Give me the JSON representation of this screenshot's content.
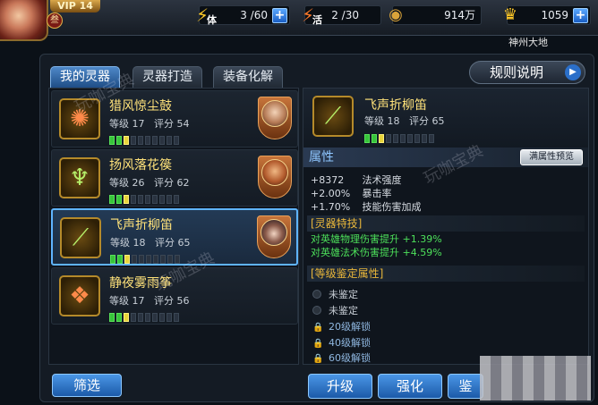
{
  "header": {
    "vip_label": "VIP 14",
    "vip_rank": "叁",
    "stamina": {
      "icon_label": "体",
      "value": "3 /60"
    },
    "vitality": {
      "icon_label": "活",
      "value": "2 /30"
    },
    "coins": {
      "value": "914万"
    },
    "gold": {
      "value": "1059"
    },
    "location": "神州大地"
  },
  "tabs": [
    {
      "label": "我的灵器",
      "active": true
    },
    {
      "label": "灵器打造",
      "active": false
    },
    {
      "label": "装备化解",
      "active": false
    }
  ],
  "rules_button": "规则说明",
  "items": [
    {
      "name": "猎风惊尘鼓",
      "level": "等级 17",
      "score": "评分 54",
      "bars_on": 3,
      "selected": false
    },
    {
      "name": "扬风落花篌",
      "level": "等级 26",
      "score": "评分 62",
      "bars_on": 3,
      "selected": false
    },
    {
      "name": "飞声折柳笛",
      "level": "等级 18",
      "score": "评分 65",
      "bars_on": 3,
      "selected": true
    },
    {
      "name": "静夜雾雨筝",
      "level": "等级 17",
      "score": "评分 56",
      "bars_on": 3,
      "selected": false
    }
  ],
  "filter_button": "筛选",
  "detail": {
    "name": "飞声折柳笛",
    "level": "等级 18",
    "score": "评分 65",
    "attr_title": "属性",
    "full_attr_button": "满属性预览",
    "attrs": [
      {
        "value": "+8372",
        "label": "法术强度"
      },
      {
        "value": "+2.00%",
        "label": "暴击率"
      },
      {
        "value": "+1.70%",
        "label": "技能伤害加成"
      }
    ],
    "special_title": "[灵器特技]",
    "specials": [
      "对英雄物理伤害提升 +1.39%",
      "对英雄法术伤害提升 +4.59%"
    ],
    "appraisal_title": "[等级鉴定属性]",
    "slots": [
      {
        "label": "未鉴定",
        "locked": false
      },
      {
        "label": "未鉴定",
        "locked": false
      },
      {
        "label": "20级解锁",
        "locked": true
      },
      {
        "label": "40级解锁",
        "locked": true
      },
      {
        "label": "60级解锁",
        "locked": true
      }
    ]
  },
  "actions": {
    "upgrade": "升级",
    "enhance": "强化",
    "appraise": "鉴"
  },
  "watermark": "玩咖宝典",
  "colors": {
    "accent": "#5fb4ff",
    "name": "#ffe27a",
    "special": "#4de05a",
    "section": "#e8b63a"
  }
}
